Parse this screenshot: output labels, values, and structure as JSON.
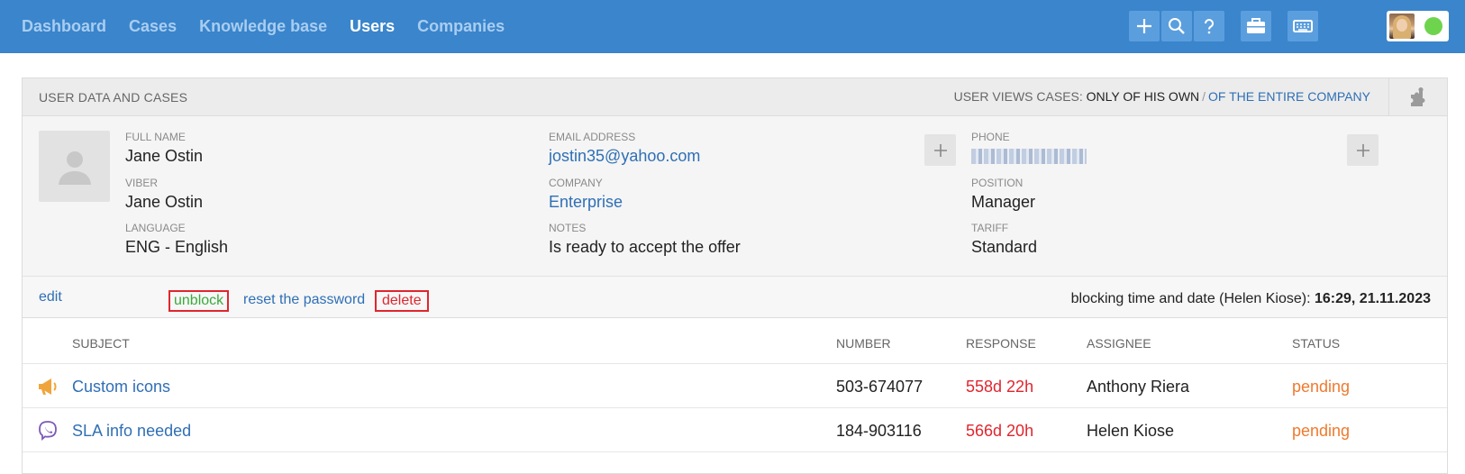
{
  "nav": {
    "items": [
      {
        "label": "Dashboard",
        "active": false
      },
      {
        "label": "Cases",
        "active": false
      },
      {
        "label": "Knowledge base",
        "active": false
      },
      {
        "label": "Users",
        "active": true
      },
      {
        "label": "Companies",
        "active": false
      }
    ],
    "tools": [
      "plus-icon",
      "search-icon",
      "question-icon",
      "briefcase-icon",
      "keyboard-icon"
    ],
    "user_status_color": "#6ed44d"
  },
  "panel": {
    "title": "USER DATA AND CASES",
    "views_label": "USER VIEWS CASES:",
    "views_own": "ONLY OF HIS OWN",
    "views_sep": "/",
    "views_company": "OF THE ENTIRE COMPANY"
  },
  "user": {
    "full_name_label": "FULL NAME",
    "full_name": "Jane Ostin",
    "viber_label": "VIBER",
    "viber": "Jane Ostin",
    "language_label": "LANGUAGE",
    "language": "ENG - English",
    "email_label": "EMAIL ADDRESS",
    "email": "jostin35@yahoo.com",
    "company_label": "COMPANY",
    "company": "Enterprise",
    "notes_label": "NOTES",
    "notes": "Is ready to accept the offer",
    "phone_label": "PHONE",
    "position_label": "POSITION",
    "position": "Manager",
    "tariff_label": "TARIFF",
    "tariff": "Standard"
  },
  "actions": {
    "edit": "edit",
    "unblock": "unblock",
    "reset": "reset the password",
    "delete": "delete",
    "blocking_label": "blocking time and date (Helen Kiose):",
    "blocking_value": "16:29, 21.11.2023"
  },
  "table": {
    "headers": {
      "subject": "SUBJECT",
      "number": "NUMBER",
      "response": "RESPONSE",
      "assignee": "ASSIGNEE",
      "status": "STATUS"
    },
    "rows": [
      {
        "icon": "megaphone-icon",
        "subject": "Custom icons",
        "number": "503-674077",
        "response": "558d 22h",
        "assignee": "Anthony Riera",
        "status": "pending"
      },
      {
        "icon": "viber-icon",
        "subject": "SLA info needed",
        "number": "184-903116",
        "response": "566d 20h",
        "assignee": "Helen Kiose",
        "status": "pending"
      }
    ]
  }
}
